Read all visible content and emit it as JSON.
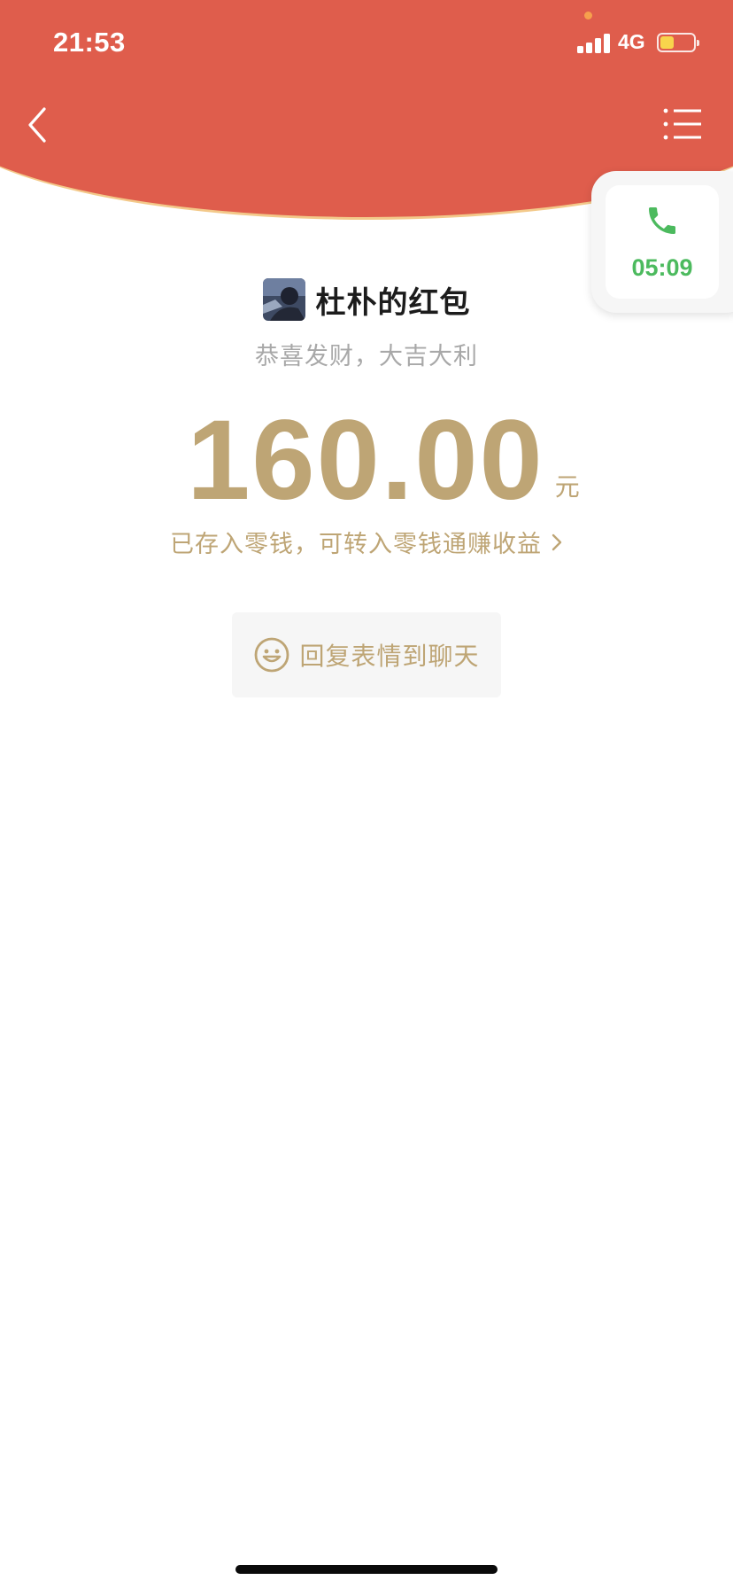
{
  "status_bar": {
    "time": "21:53",
    "network": "4G",
    "battery_level": 0.42,
    "battery_color": "#F8D44C"
  },
  "nav": {
    "back_icon": "chevron-left-icon",
    "menu_icon": "list-menu-icon"
  },
  "call_widget": {
    "icon": "phone-icon",
    "duration": "05:09",
    "color": "#4CBA5E"
  },
  "red_packet": {
    "sender_title": "杜朴的红包",
    "blessing": "恭喜发财，大吉大利",
    "amount": "160.00",
    "unit": "元",
    "balance_note": "已存入零钱，可转入零钱通赚收益",
    "reply_label": "回复表情到聊天",
    "reply_icon": "smile-icon"
  },
  "colors": {
    "header_red": "#DF5D4C",
    "gold": "#BEA575",
    "header_rim": "#F3C98A"
  }
}
